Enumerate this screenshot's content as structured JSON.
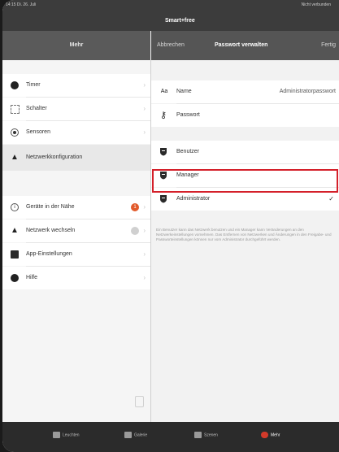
{
  "status_bar": {
    "time": "14:15  Di. 26. Juli",
    "right": "Nicht verbunden"
  },
  "app": {
    "title": "Smart+free"
  },
  "left_nav": {
    "title": "Mehr"
  },
  "right_nav": {
    "cancel": "Abbrechen",
    "title": "Passwort verwalten",
    "done": "Fertig"
  },
  "sidebar": {
    "items": [
      {
        "label": "Timer",
        "icon": "circle-dark"
      },
      {
        "label": "Schalter",
        "icon": "square-dotted"
      },
      {
        "label": "Sensoren",
        "icon": "radio-dot"
      },
      {
        "label": "Netzwerkkonfiguration",
        "icon": "network-triangle"
      },
      {
        "label": "Geräte in der Nähe",
        "icon": "info-circle",
        "badge": "1"
      },
      {
        "label": "Netzwerk wechseln",
        "icon": "network-triangle",
        "badge": ""
      },
      {
        "label": "App-Einstellungen",
        "icon": "settings-square"
      },
      {
        "label": "Hilfe",
        "icon": "circle-dark"
      }
    ]
  },
  "name_row": {
    "icon_text": "Aa",
    "label": "Name",
    "value": "Administratorpasswort"
  },
  "password_row": {
    "label": "Passwort"
  },
  "roles": [
    {
      "label": "Benutzer",
      "checked": false
    },
    {
      "label": "Manager",
      "checked": false
    },
    {
      "label": "Administrator",
      "checked": true
    }
  ],
  "roles_check": "✓",
  "footer_text": "Ein Benutzer kann das Netzwerk benutzen und ein Manager kann Veränderungen an den Netzwerkeinstellungen vornehmen. Das Entfernen von Netzwerken und Änderungen in den Freigabe- und Passworteinstellungen können nur vom Administrator durchgeführt werden.",
  "tabbar": {
    "tabs": [
      {
        "label": "Leuchten"
      },
      {
        "label": "Galerie"
      },
      {
        "label": "Szenen"
      },
      {
        "label": "Mehr",
        "active": true
      }
    ]
  },
  "colors": {
    "highlight": "#d4202a",
    "badge": "#e25a2b",
    "active_tab": "#d23a2a"
  }
}
